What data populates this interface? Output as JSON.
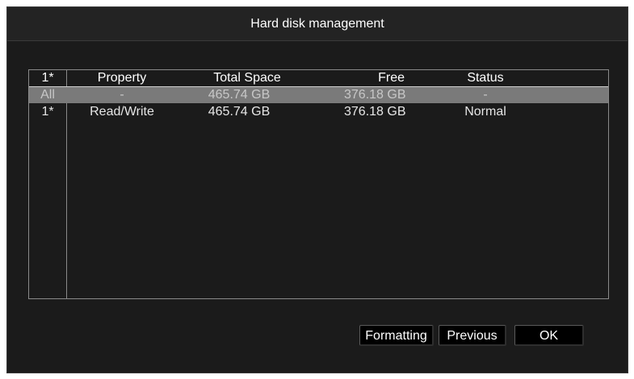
{
  "window": {
    "title": "Hard disk management"
  },
  "table": {
    "headers": {
      "id": "1*",
      "property": "Property",
      "total": "Total Space",
      "free": "Free",
      "status": "Status"
    },
    "rows": [
      {
        "id": "All",
        "property": "-",
        "total": "465.74 GB",
        "free": "376.18 GB",
        "status": "-",
        "selected": true
      },
      {
        "id": "1*",
        "property": "Read/Write",
        "total": "465.74 GB",
        "free": "376.18 GB",
        "status": "Normal",
        "selected": false
      }
    ]
  },
  "buttons": {
    "formatting": "Formatting",
    "previous": "Previous",
    "ok": "OK"
  },
  "colors": {
    "background": "#1b1b1b",
    "selected_row": "#7a7a7a",
    "border": "#8a8a8a",
    "button": "#000000"
  }
}
